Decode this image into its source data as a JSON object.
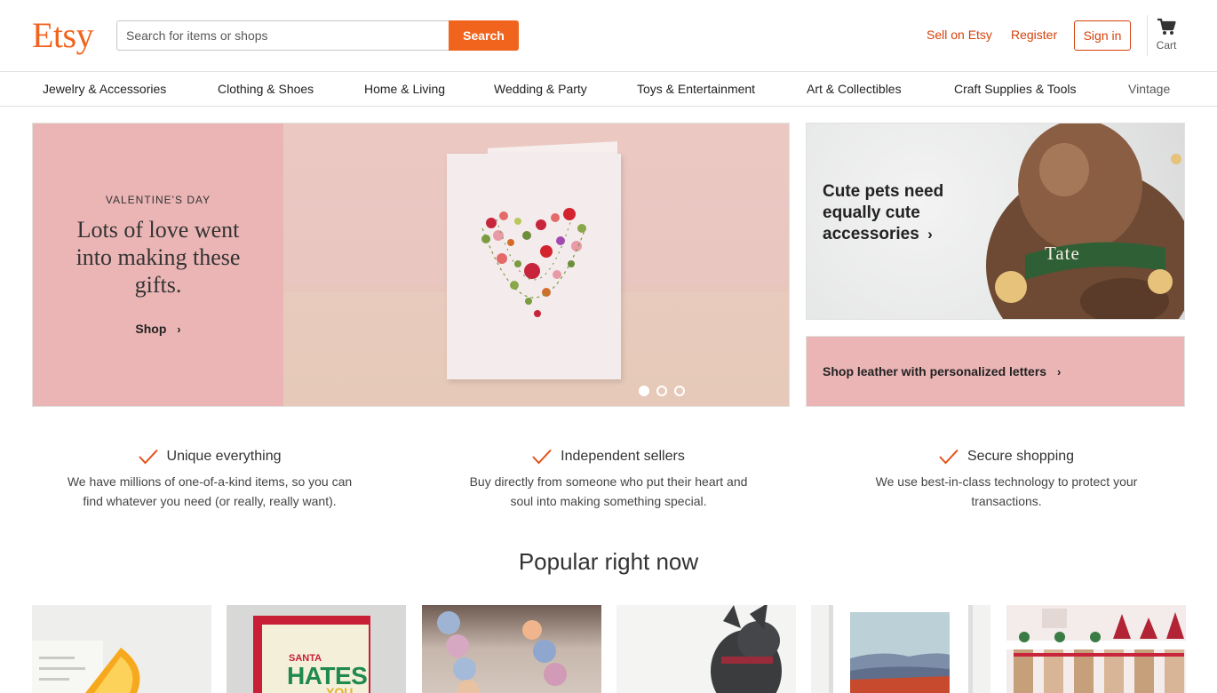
{
  "header": {
    "logo": "Etsy",
    "search_placeholder": "Search for items or shops",
    "search_button": "Search",
    "sell_link": "Sell on Etsy",
    "register_link": "Register",
    "signin_button": "Sign in",
    "cart_label": "Cart"
  },
  "categories": [
    "Jewelry & Accessories",
    "Clothing & Shoes",
    "Home & Living",
    "Wedding & Party",
    "Toys & Entertainment",
    "Art & Collectibles",
    "Craft Supplies & Tools",
    "Vintage"
  ],
  "hero": {
    "kicker": "VALENTINE'S DAY",
    "title": "Lots of love went into making these gifts.",
    "shop_link": "Shop",
    "slide_count": 3,
    "active_slide": 1
  },
  "promos": {
    "pets_title": "Cute pets need equally cute accessories",
    "collar_name": "Tate",
    "leather_link": "Shop leather with personalized letters"
  },
  "value_props": [
    {
      "title": "Unique everything",
      "body": "We have millions of one-of-a-kind items, so you can find whatever you need (or really, really want)."
    },
    {
      "title": "Independent sellers",
      "body": "Buy directly from someone who put their heart and soul into making something special."
    },
    {
      "title": "Secure shopping",
      "body": "We use best-in-class technology to protect your transactions."
    }
  ],
  "popular": {
    "title": "Popular right now",
    "tile2_text_top": "SANTA",
    "tile2_text_main": "HATES",
    "tile2_text_bottom": "YOU"
  },
  "colors": {
    "brand": "#f1641e",
    "link": "#d5420d",
    "pink": "#ebb5b5"
  }
}
